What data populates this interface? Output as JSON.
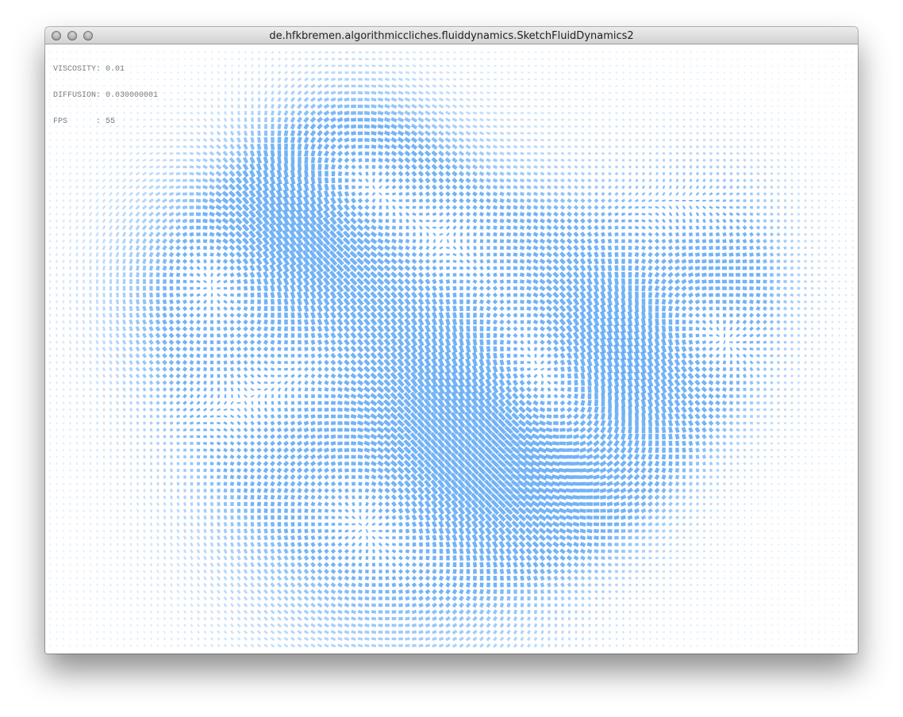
{
  "window": {
    "title": "de.hfkbremen.algorithmiccliches.fluiddynamics.SketchFluidDynamics2"
  },
  "hud": {
    "viscosity": "VISCOSITY: 0.01",
    "diffusion": "DIFFUSION: 0.030000001",
    "fps": "FPS      : 55"
  },
  "colors": {
    "vector": "#5aa6f5",
    "background": "#ffffff"
  },
  "icons": [
    "close-button",
    "minimize-button",
    "zoom-button"
  ]
}
